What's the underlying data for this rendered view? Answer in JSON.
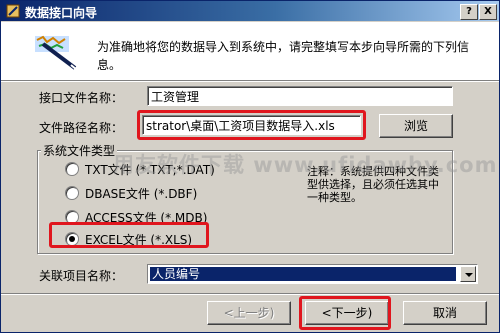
{
  "window": {
    "title": "数据接口向导",
    "help_btn": "?",
    "close_btn": "X"
  },
  "header": {
    "description": "为准确地将您的数据导入到系统中，请完整填写本步向导所需的下列信息。"
  },
  "form": {
    "interface_name_label": "接口文件名称：",
    "interface_name_value": "工资管理",
    "file_path_label": "文件路径名称：",
    "file_path_value": "strator\\桌面\\工资项目数据导入.xls",
    "browse_label": "浏览",
    "file_type_group_label": "系统文件类型",
    "file_types": [
      {
        "label": "TXT文件 (*.TXT;*.DAT)",
        "selected": false
      },
      {
        "label": "DBASE文件  (*.DBF)",
        "selected": false
      },
      {
        "label": "ACCESS文件 (*.MDB)",
        "selected": false
      },
      {
        "label": "EXCEL文件  (*.XLS)",
        "selected": true
      }
    ],
    "note": "注释：系统提供四种文件类型供选择，且必须任选其中一种类型。",
    "related_item_label": "关联项目名称：",
    "related_item_value": "人员编号"
  },
  "buttons": {
    "prev": "<上一步)",
    "next": "<下一步)",
    "cancel": "取消"
  },
  "watermark": "用友软件下载 www.ufidawhy.com",
  "colors": {
    "titlebar": "#0a246a",
    "highlight": "#e0161e",
    "dialog_bg": "#d4d0c8"
  }
}
